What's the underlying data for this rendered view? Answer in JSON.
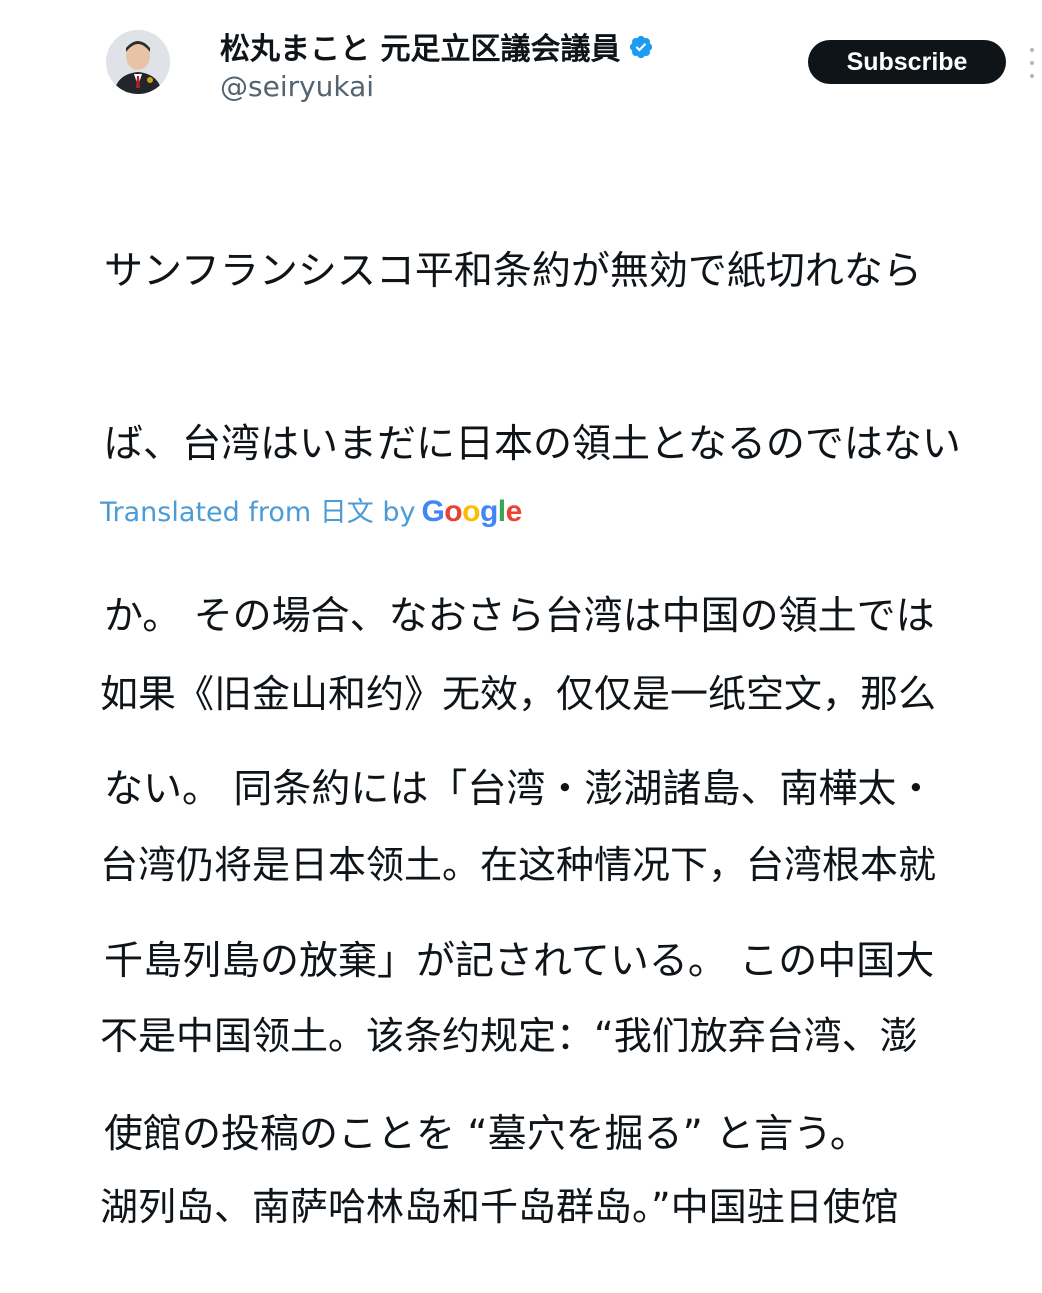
{
  "author": {
    "display_name": "松丸まこと 元足立区議会議員",
    "handle": "@seiryukai",
    "verified_icon": "verified-badge-icon",
    "avatar": "avatar"
  },
  "actions": {
    "subscribe_label": "Subscribe",
    "more_icon": "more-options-icon"
  },
  "tweet": {
    "lines": [
      "サンフランシスコ平和条約が無効で紙切れなら",
      "ば、台湾はいまだに日本の領土となるのではない",
      "か。 その場合、なおさら台湾は中国の領土では",
      "ない。 同条約には「台湾・澎湖諸島、南樺太・",
      "千島列島の放棄」が記されている。 この中国大",
      "使館の投稿のことを “墓穴を掘る” と言う。"
    ]
  },
  "translation": {
    "prefix": "Translated from 日文 by",
    "google_letters": [
      {
        "ch": "G",
        "color": "#4285F4"
      },
      {
        "ch": "o",
        "color": "#EA4335"
      },
      {
        "ch": "o",
        "color": "#FBBC05"
      },
      {
        "ch": "g",
        "color": "#4285F4"
      },
      {
        "ch": "l",
        "color": "#34A853"
      },
      {
        "ch": "e",
        "color": "#EA4335"
      }
    ],
    "lines": [
      "如果《旧金山和约》无效，仅仅是一纸空文，那么",
      "台湾仍将是日本领土。在这种情况下，台湾根本就",
      "不是中国领土。该条约规定：“我们放弃台湾、澎",
      "湖列岛、南萨哈林岛和千岛群岛。”中国驻日使馆"
    ]
  },
  "colors": {
    "link_blue": "#4a9bd6",
    "verified_blue": "#1d9bf0",
    "button_bg": "#0f1419",
    "text": "#0f1419",
    "secondary_text": "#536471"
  }
}
